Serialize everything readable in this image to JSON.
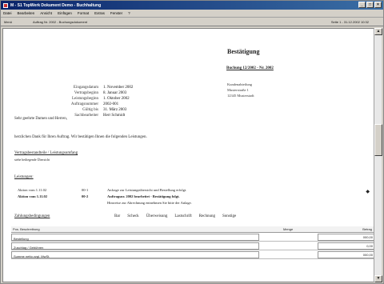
{
  "window": {
    "title": "M - S1 TopWerk Dokument Demo - Buchhaltung"
  },
  "menu": [
    "Datei",
    "Bearbeiten",
    "Ansicht",
    "Einfügen",
    "Format",
    "Extras",
    "Fenster",
    "?"
  ],
  "toolbar": {
    "left_label": "Menü",
    "path": "Auftrag Nr. 2002 - Buchungsdokument",
    "right_info": "Seite 1 - 31.12.2002 10:32"
  },
  "document": {
    "confirm_title": "Bestätigung",
    "confirm_sub": "Buchung 12/2002 - Nr. 2002",
    "address": [
      "Kundenabteilung",
      "Musterstraße 1",
      "12345 Musterstadt"
    ],
    "fields": [
      {
        "label": "Eingangsdatum",
        "value": "1. November 2002"
      },
      {
        "label": "Vertragsbeginn",
        "value": "8. Januar 2003"
      },
      {
        "label": "Leistungsbeginn",
        "value": "1. Oktober 2002"
      },
      {
        "label": "Auftragsnummer",
        "value": "2002-001"
      },
      {
        "label": "Gültig bis",
        "value": "31. März 2003"
      },
      {
        "label": "Sachbearbeiter",
        "value": "Herr Schmidt"
      }
    ],
    "greeting": "Sehr geehrte Damen und Herren,",
    "body_text": "herzlichen Dank für Ihren Auftrag. Wir bestätigen Ihnen die folgenden Leistungen.",
    "section1_title": "Vertragsbestandteile / Leistungsumfang",
    "section1_sub": "siehe beiliegende Übersicht",
    "services_title": "Leistungen:",
    "services": [
      {
        "date": "Aktion vom 1.11.02",
        "code": "00-1",
        "text": "Anfrage zur Leistungsübersicht und Bestellung erfolgt."
      },
      {
        "date": "Aktion vom 1.11.02",
        "code": "00-2",
        "text": "Auftragsnr. 2002 bearbeitet - Bestätigung folgt."
      },
      {
        "date": "",
        "code": "",
        "text": "Hinweise zur Abrechnung entnehmen Sie bitte der Anlage."
      }
    ],
    "payment_title": "Zahlungsbedingungen",
    "payment_options": [
      "Bar",
      "Scheck",
      "Überweisung",
      "Lastschrift",
      "Rechnung",
      "Sonstige"
    ]
  },
  "items": {
    "header_left": "Pos.  Beschreibung",
    "header_mid": "Menge",
    "header_right": "Betrag",
    "rows": [
      {
        "desc": "Bestellung",
        "amount": "000,00"
      },
      {
        "desc": "Zuschlag / Gebühren",
        "amount": "0,00"
      },
      {
        "desc": "Summe netto zzgl. MwSt.",
        "amount": "000,00"
      }
    ]
  }
}
